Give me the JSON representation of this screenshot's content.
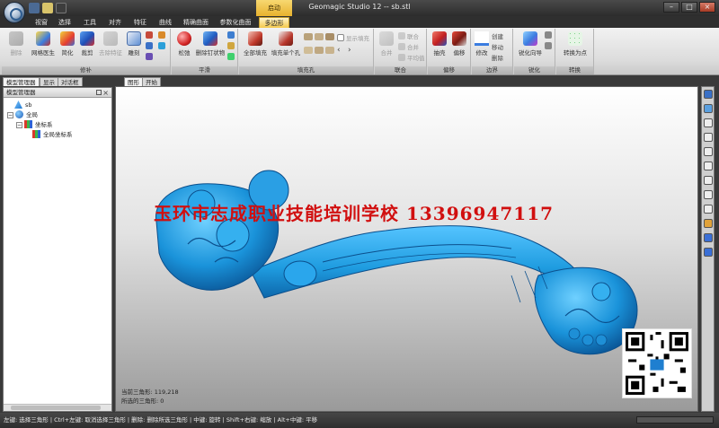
{
  "window": {
    "title": "Geomagic Studio 12 -- sb.stl",
    "context_tab_label": "启动"
  },
  "ribbon_tabs": [
    "视窗",
    "选择",
    "工具",
    "对齐",
    "特征",
    "曲线",
    "精确曲面",
    "参数化曲面",
    "多边形"
  ],
  "active_tab": "多边形",
  "groups": {
    "repair": {
      "label": "修补",
      "buttons": [
        "删除",
        "网格医生",
        "简化",
        "裁剪",
        "去除特征",
        "雕刻"
      ]
    },
    "smooth": {
      "label": "平滑",
      "buttons": [
        "松弛",
        "删除钉状物"
      ]
    },
    "fill": {
      "label": "填充孔",
      "buttons": [
        "全部填充",
        "填充单个孔"
      ],
      "checkbox": "显示填充"
    },
    "combine": {
      "label": "联合",
      "buttons": [
        "合并"
      ],
      "small": [
        "联合",
        "合并",
        "平均值"
      ]
    },
    "offset": {
      "label": "偏移",
      "buttons": [
        "抽壳",
        "偏移"
      ]
    },
    "boundary": {
      "label": "边界",
      "buttons": [
        "修改"
      ],
      "small": [
        "创建",
        "移动",
        "删除"
      ]
    },
    "sharpen": {
      "label": "锐化",
      "buttons": [
        "锐化向导"
      ]
    },
    "convert": {
      "label": "转换",
      "buttons": [
        "转换为点"
      ]
    }
  },
  "doc_tabs": [
    "图形",
    "开始"
  ],
  "panel": {
    "tabs": [
      "模型管理器",
      "显示",
      "对话框"
    ],
    "title": "模型管理器",
    "tree": [
      "sb",
      "全局",
      "坐标系",
      "全局坐标系"
    ]
  },
  "viewport": {
    "watermark": "玉环市志成职业技能培训学校 13396947117",
    "stats_triangles": "当前三角形: 119,218",
    "stats_selected": "所选的三角形: 0"
  },
  "status_bar": "左键: 选择三角形 | Ctrl+左键: 取消选择三角形 | 删除: 删除所选三角形 | 中键: 旋转 | Shift+右键: 缩放 | Alt+中键: 平移",
  "colors": {
    "model": "#1f9ce0",
    "watermark": "#d10f0f",
    "active_tab": "#f5c94c"
  }
}
